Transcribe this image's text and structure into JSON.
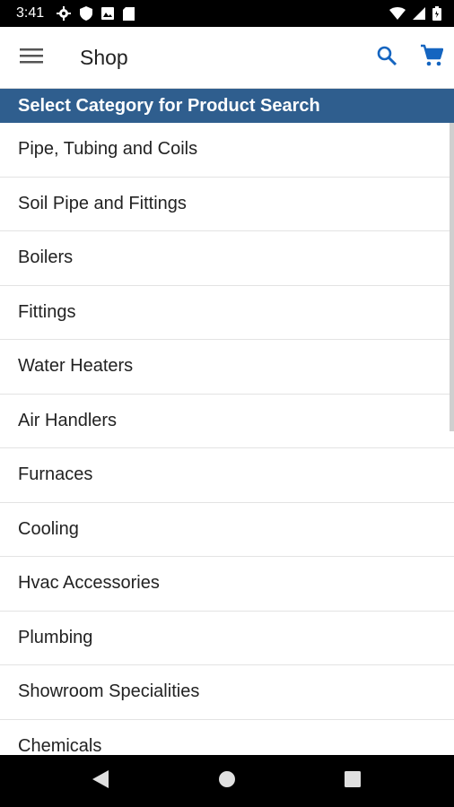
{
  "status_bar": {
    "time": "3:41",
    "left_icons": [
      "gear-icon",
      "shield-icon",
      "photo-icon",
      "sd-card-icon"
    ],
    "right_icons": [
      "wifi-icon",
      "signal-icon",
      "battery-icon"
    ]
  },
  "app_bar": {
    "title": "Shop",
    "menu_icon": "menu-icon",
    "search_icon": "search-icon",
    "cart_icon": "cart-icon",
    "accent_color": "#1565c0"
  },
  "category_header": {
    "text": "Select Category for Product Search",
    "background": "#2f5e8e"
  },
  "categories": [
    "Pipe, Tubing and Coils",
    "Soil Pipe and Fittings",
    "Boilers",
    "Fittings",
    "Water Heaters",
    "Air Handlers",
    "Furnaces",
    "Cooling",
    "Hvac Accessories",
    "Plumbing",
    "Showroom Specialities",
    "Chemicals"
  ],
  "nav_bar": {
    "back_icon": "back-icon",
    "home_icon": "home-icon",
    "recents_icon": "recents-icon"
  }
}
